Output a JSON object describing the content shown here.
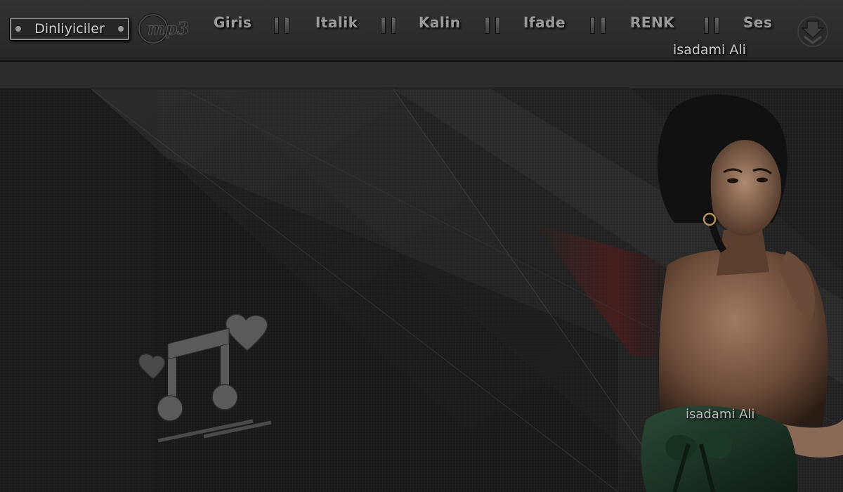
{
  "toolbar": {
    "listeners_label": "Dinliyiciler",
    "logo_text": "mp3",
    "nav": [
      {
        "label": "Giris"
      },
      {
        "label": "Italik"
      },
      {
        "label": "Kalin"
      },
      {
        "label": "Ifade"
      },
      {
        "label": "RENK"
      },
      {
        "label": "Ses"
      }
    ],
    "menu_icon": "down-arrow-icon"
  },
  "signature": "isadami Ali",
  "colors": {
    "toolbar_bg": "#2e2e2e",
    "stage_bg": "#202020",
    "text": "#9a9a9a",
    "accent_red": "#5a1a1a",
    "dress_green": "#1f3a2a"
  }
}
